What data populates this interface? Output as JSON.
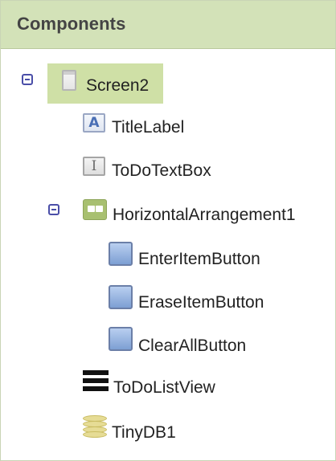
{
  "panel": {
    "title": "Components"
  },
  "tree": {
    "screen": {
      "label": "Screen2",
      "selected": true,
      "icon": "screen-icon"
    },
    "items": [
      {
        "label": "TitleLabel",
        "icon": "label-icon"
      },
      {
        "label": "ToDoTextBox",
        "icon": "textbox-icon"
      },
      {
        "label": "HorizontalArrangement1",
        "icon": "horizontal-arrangement-icon"
      },
      {
        "label": "EnterItemButton",
        "icon": "button-icon"
      },
      {
        "label": "EraseItemButton",
        "icon": "button-icon"
      },
      {
        "label": "ClearAllButton",
        "icon": "button-icon"
      },
      {
        "label": "ToDoListView",
        "icon": "listview-icon"
      },
      {
        "label": "TinyDB1",
        "icon": "tinydb-icon"
      }
    ]
  },
  "colors": {
    "header_bg": "#d3e2b8",
    "selection_bg": "#cfe0a6",
    "toggle": "#4a4ea8",
    "text": "#222222"
  }
}
